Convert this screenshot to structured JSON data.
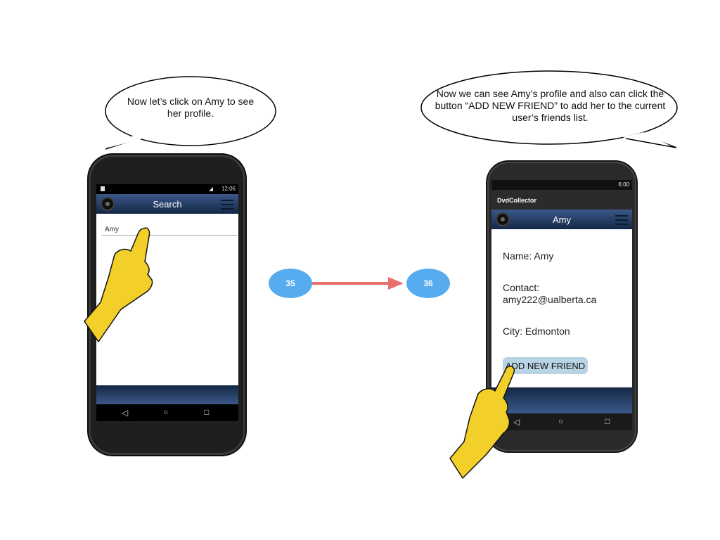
{
  "bubbles": {
    "left_text": "Now let’s click on Amy to see her profile.",
    "right_text": "Now we can see Amy’s profile and also can click the button “ADD NEW FRIEND” to add her to the current user’s friends list."
  },
  "left_screen": {
    "status_time": "12:06",
    "title": "Search",
    "search_value": "Amy"
  },
  "right_screen": {
    "status_time": "6:00",
    "app_name": "DvdCollector",
    "title": "Amy",
    "name_line": "Name: Amy",
    "contact_label": "Contact:",
    "contact_value": "amy222@ualberta.ca",
    "city_line": "City: Edmonton",
    "add_button": "ADD NEW FRIEND"
  },
  "flow": {
    "from_step": "35",
    "to_step": "36"
  },
  "icons": [
    "disc-icon",
    "hamburger-menu-icon",
    "back-icon",
    "home-icon",
    "recents-icon",
    "hand-pointer-icon"
  ],
  "colors": {
    "toolbar_gradient_top": "#3b5889",
    "toolbar_gradient_bottom": "#142845",
    "node_blue": "#56acef",
    "arrow_red": "#e96e6e",
    "button_bg": "#b8d3e4",
    "hand_yellow": "#f3cf2a"
  }
}
